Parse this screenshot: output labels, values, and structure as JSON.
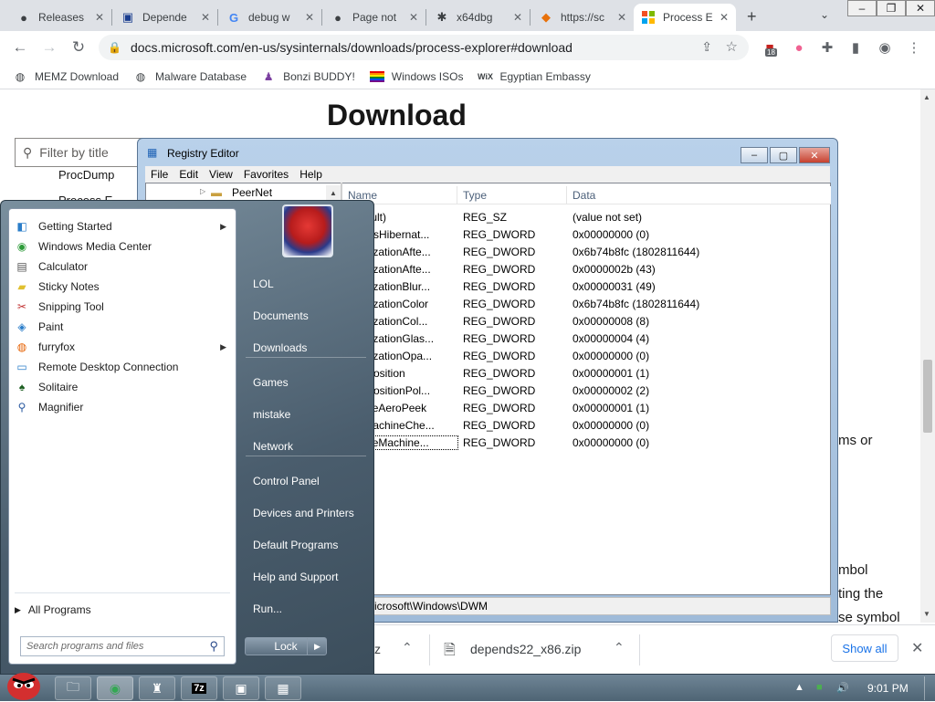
{
  "browser": {
    "tabs": [
      {
        "title": "Releases",
        "icon": "github-icon"
      },
      {
        "title": "Depende",
        "icon": "depends-icon"
      },
      {
        "title": "debug w",
        "icon": "google-icon"
      },
      {
        "title": "Page not",
        "icon": "github-icon"
      },
      {
        "title": "x64dbg",
        "icon": "bug-icon"
      },
      {
        "title": "https://sc",
        "icon": "diamond-icon"
      },
      {
        "title": "Process E",
        "icon": "microsoft-icon"
      }
    ],
    "url": "docs.microsoft.com/en-us/sysinternals/downloads/process-explorer#download",
    "extension_badge": "18",
    "bookmarks": [
      {
        "label": "MEMZ Download",
        "icon": "globe-icon"
      },
      {
        "label": "Malware Database",
        "icon": "globe-icon"
      },
      {
        "label": "Bonzi BUDDY!",
        "icon": "bonzi-icon"
      },
      {
        "label": "Windows ISOs",
        "icon": "windows-flag-icon"
      },
      {
        "label": "Egyptian Embassy",
        "icon": "wix-icon"
      }
    ]
  },
  "page": {
    "heading": "Download",
    "filter_placeholder": "Filter by title",
    "nav_items": [
      "ProcDump",
      "Process E"
    ],
    "side_text": [
      "ms or",
      "mbol",
      "ting the",
      "se symbol"
    ]
  },
  "downloads": {
    "items": [
      {
        "name": "z"
      },
      {
        "name": "depends22_x86.zip"
      }
    ],
    "show_all": "Show all"
  },
  "regedit": {
    "title": "Registry Editor",
    "menu": [
      "File",
      "Edit",
      "View",
      "Favorites",
      "Help"
    ],
    "tree_item": "PeerNet",
    "columns": [
      "Name",
      "Type",
      "Data"
    ],
    "rows": [
      {
        "name": "(Default)",
        "type": "REG_SZ",
        "data": "(value not set)"
      },
      {
        "name": "AlwaysHibernat...",
        "type": "REG_DWORD",
        "data": "0x00000000 (0)"
      },
      {
        "name": "ColorizationAfte...",
        "type": "REG_DWORD",
        "data": "0x6b74b8fc (1802811644)"
      },
      {
        "name": "ColorizationAfte...",
        "type": "REG_DWORD",
        "data": "0x0000002b (43)"
      },
      {
        "name": "ColorizationBlur...",
        "type": "REG_DWORD",
        "data": "0x00000031 (49)"
      },
      {
        "name": "ColorizationColor",
        "type": "REG_DWORD",
        "data": "0x6b74b8fc (1802811644)"
      },
      {
        "name": "ColorizationCol...",
        "type": "REG_DWORD",
        "data": "0x00000008 (8)"
      },
      {
        "name": "ColorizationGlas...",
        "type": "REG_DWORD",
        "data": "0x00000004 (4)"
      },
      {
        "name": "ColorizationOpa...",
        "type": "REG_DWORD",
        "data": "0x00000000 (0)"
      },
      {
        "name": "Composition",
        "type": "REG_DWORD",
        "data": "0x00000001 (1)"
      },
      {
        "name": "CompositionPol...",
        "type": "REG_DWORD",
        "data": "0x00000002 (2)"
      },
      {
        "name": "EnableAeroPeek",
        "type": "REG_DWORD",
        "data": "0x00000001 (1)"
      },
      {
        "name": "UseMachineChe...",
        "type": "REG_DWORD",
        "data": "0x00000000 (0)"
      },
      {
        "name": "EnableMachine...",
        "type": "REG_DWORD",
        "data": "0x00000000 (0)"
      }
    ],
    "status_path": "icrosoft\\Windows\\DWM"
  },
  "startmenu": {
    "programs": [
      {
        "label": "Getting Started",
        "icon": "getting-started-icon",
        "arrow": true
      },
      {
        "label": "Windows Media Center",
        "icon": "media-center-icon",
        "arrow": false
      },
      {
        "label": "Calculator",
        "icon": "calculator-icon",
        "arrow": false
      },
      {
        "label": "Sticky Notes",
        "icon": "sticky-notes-icon",
        "arrow": false
      },
      {
        "label": "Snipping Tool",
        "icon": "snipping-tool-icon",
        "arrow": false
      },
      {
        "label": "Paint",
        "icon": "paint-icon",
        "arrow": false
      },
      {
        "label": "furryfox",
        "icon": "firefox-icon",
        "arrow": true
      },
      {
        "label": "Remote Desktop Connection",
        "icon": "remote-desktop-icon",
        "arrow": false
      },
      {
        "label": "Solitaire",
        "icon": "solitaire-icon",
        "arrow": false
      },
      {
        "label": "Magnifier",
        "icon": "magnifier-icon",
        "arrow": false
      }
    ],
    "all_programs": "All Programs",
    "search_placeholder": "Search programs and files",
    "right_items": [
      "LOL",
      "Documents",
      "Downloads",
      "Games",
      "mistake",
      "Network",
      "Control Panel",
      "Devices and Printers",
      "Default Programs",
      "Help and Support",
      "Run..."
    ],
    "lock_label": "Lock"
  },
  "taskbar": {
    "clock": "9:01 PM"
  }
}
